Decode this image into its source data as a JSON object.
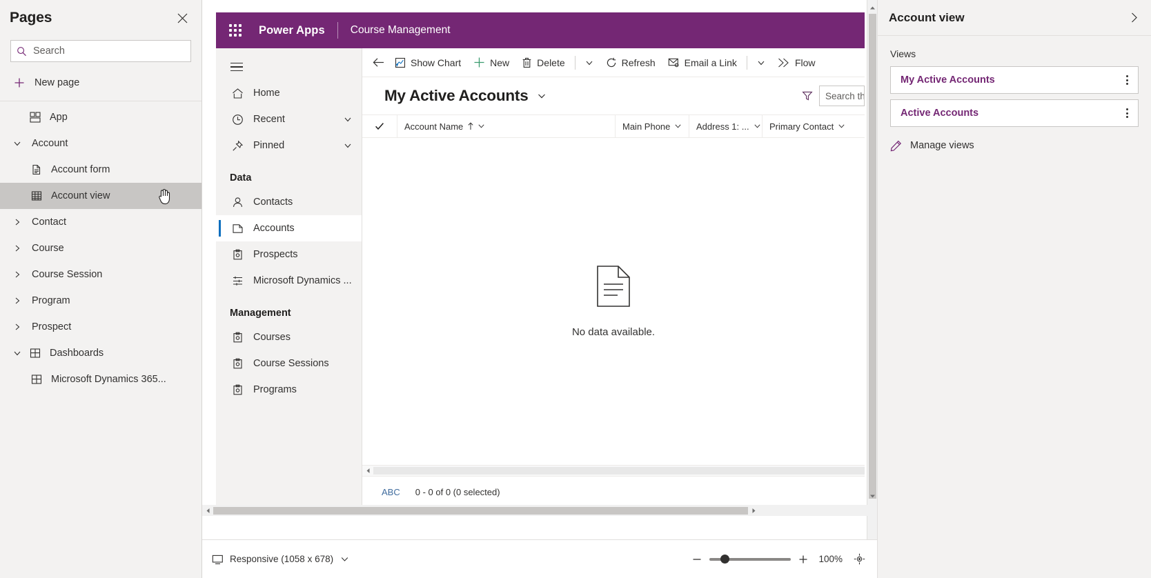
{
  "pages_panel": {
    "title": "Pages",
    "close_icon": "close-icon",
    "search": {
      "placeholder": "Search",
      "value": "",
      "icon": "search-icon"
    },
    "new_page": {
      "label": "New page",
      "icon": "plus-icon"
    },
    "tree": [
      {
        "label": "App",
        "icon": "app-icon",
        "level": 0,
        "expandable": false,
        "selected": false
      },
      {
        "label": "Account",
        "icon": "",
        "level": 0,
        "expandable": true,
        "expanded": true,
        "selected": false
      },
      {
        "label": "Account form",
        "icon": "form-icon",
        "level": 1,
        "expandable": false,
        "selected": false
      },
      {
        "label": "Account view",
        "icon": "view-grid-icon",
        "level": 1,
        "expandable": false,
        "selected": true
      },
      {
        "label": "Contact",
        "icon": "",
        "level": 0,
        "expandable": true,
        "expanded": false,
        "selected": false
      },
      {
        "label": "Course",
        "icon": "",
        "level": 0,
        "expandable": true,
        "expanded": false,
        "selected": false
      },
      {
        "label": "Course Session",
        "icon": "",
        "level": 0,
        "expandable": true,
        "expanded": false,
        "selected": false
      },
      {
        "label": "Program",
        "icon": "",
        "level": 0,
        "expandable": true,
        "expanded": false,
        "selected": false
      },
      {
        "label": "Prospect",
        "icon": "",
        "level": 0,
        "expandable": true,
        "expanded": false,
        "selected": false
      },
      {
        "label": "Dashboards",
        "icon": "dashboard-icon",
        "level": 0,
        "expandable": true,
        "expanded": true,
        "selected": false
      },
      {
        "label": "Microsoft Dynamics 365...",
        "icon": "dashboard-icon",
        "level": 1,
        "expandable": false,
        "selected": false
      }
    ]
  },
  "app_preview": {
    "topbar": {
      "waffle_icon": "waffle-icon",
      "brand": "Power Apps",
      "app_name": "Course Management",
      "brand_color": "#742774"
    },
    "sitemap": {
      "hamburger_icon": "hamburger-icon",
      "top_items": [
        {
          "label": "Home",
          "icon": "home-icon",
          "expandable": false,
          "active": false
        },
        {
          "label": "Recent",
          "icon": "clock-icon",
          "expandable": true,
          "active": false
        },
        {
          "label": "Pinned",
          "icon": "pin-icon",
          "expandable": true,
          "active": false
        }
      ],
      "groups": [
        {
          "title": "Data",
          "items": [
            {
              "label": "Contacts",
              "icon": "contact-icon",
              "active": false
            },
            {
              "label": "Accounts",
              "icon": "account-icon",
              "active": true
            },
            {
              "label": "Prospects",
              "icon": "clipboard-icon",
              "active": false
            },
            {
              "label": "Microsoft Dynamics ...",
              "icon": "settings-slider-icon",
              "active": false
            }
          ]
        },
        {
          "title": "Management",
          "items": [
            {
              "label": "Courses",
              "icon": "clipboard-icon",
              "active": false
            },
            {
              "label": "Course Sessions",
              "icon": "clipboard-icon",
              "active": false
            },
            {
              "label": "Programs",
              "icon": "clipboard-icon",
              "active": false
            }
          ]
        }
      ]
    },
    "command_bar": {
      "back_icon": "back-arrow-icon",
      "commands": [
        {
          "label": "Show Chart",
          "icon": "chart-icon"
        },
        {
          "label": "New",
          "icon": "plus-icon"
        },
        {
          "label": "Delete",
          "icon": "trash-icon"
        },
        {
          "label": "Refresh",
          "icon": "refresh-icon"
        },
        {
          "label": "Email a Link",
          "icon": "email-link-icon"
        },
        {
          "label": "Flow",
          "icon": "flow-icon"
        }
      ],
      "overflow_icon": "chevron-down-icon"
    },
    "view_header": {
      "title": "My Active Accounts",
      "title_chevron_icon": "chevron-down-icon",
      "filter_icon": "filter-funnel-icon",
      "search_placeholder": "Search th"
    },
    "grid": {
      "select_all_icon": "checkmark-icon",
      "columns": [
        {
          "label": "Account Name",
          "sorted": true,
          "sort_icon": "sort-ascending-icon"
        },
        {
          "label": "Main Phone",
          "sorted": false
        },
        {
          "label": "Address 1: ...",
          "sorted": false
        },
        {
          "label": "Primary Contact",
          "sorted": false
        }
      ],
      "empty_icon": "document-empty-icon",
      "empty_text": "No data available.",
      "footer": {
        "abc_label": "ABC",
        "status": "0 - 0 of 0 (0 selected)"
      }
    }
  },
  "status_bar": {
    "responsive_label": "Responsive (1058 x 678)",
    "responsive_icon": "screen-icon",
    "responsive_chevron_icon": "chevron-down-icon",
    "zoom_out_icon": "minus-icon",
    "zoom_in_icon": "plus-icon",
    "zoom_percent": "100%",
    "fit_icon": "fit-to-screen-icon"
  },
  "properties_panel": {
    "title": "Account view",
    "expand_icon": "chevron-right-icon",
    "views_label": "Views",
    "views": [
      {
        "name": "My Active Accounts",
        "kebab_icon": "more-vertical-icon"
      },
      {
        "name": "Active Accounts",
        "kebab_icon": "more-vertical-icon"
      }
    ],
    "manage_views": {
      "label": "Manage views",
      "icon": "pencil-icon"
    }
  },
  "colors": {
    "brand_purple": "#742774",
    "panel_gray": "#f3f2f1",
    "selected_gray": "#c8c6c4",
    "active_blue": "#0b6fbe",
    "link_blue": "#406c9e"
  }
}
